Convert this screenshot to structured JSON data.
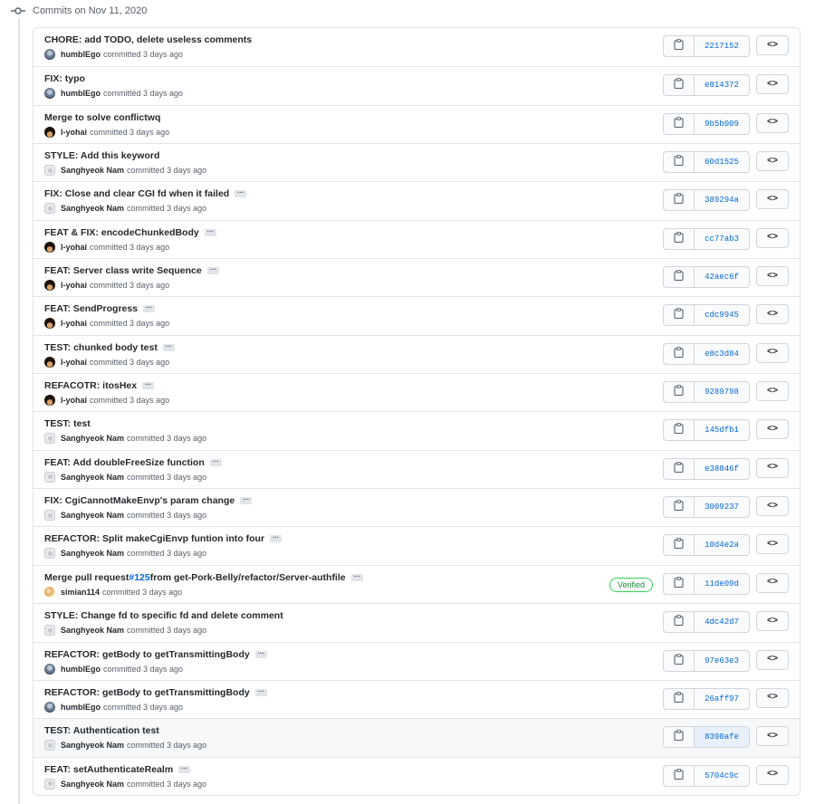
{
  "group": {
    "heading": "Commits on Nov 11, 2020"
  },
  "verb": "committed",
  "commits": [
    {
      "title": "CHORE: add TODO, delete useless comments",
      "author": "humblEgo",
      "avatar": "humble",
      "time": "3 days ago",
      "sha": "2217152",
      "has_more": false,
      "verified": false
    },
    {
      "title": "FIX: typo",
      "author": "humblEgo",
      "avatar": "humble",
      "time": "3 days ago",
      "sha": "e814372",
      "has_more": false,
      "verified": false
    },
    {
      "title": "Merge to solve conflictwq",
      "author": "l-yohai",
      "avatar": "yohai",
      "time": "3 days ago",
      "sha": "9b5b009",
      "has_more": false,
      "verified": false
    },
    {
      "title": "STYLE: Add this keyword",
      "author": "Sanghyeok Nam",
      "avatar": "default",
      "time": "3 days ago",
      "sha": "60d1525",
      "has_more": false,
      "verified": false
    },
    {
      "title": "FIX: Close and clear CGI fd when it failed",
      "author": "Sanghyeok Nam",
      "avatar": "default",
      "time": "3 days ago",
      "sha": "389294a",
      "has_more": true,
      "verified": false
    },
    {
      "title": "FEAT & FIX: encodeChunkedBody",
      "author": "l-yohai",
      "avatar": "yohai",
      "time": "3 days ago",
      "sha": "cc77ab3",
      "has_more": true,
      "verified": false
    },
    {
      "title": "FEAT: Server class write Sequence",
      "author": "l-yohai",
      "avatar": "yohai",
      "time": "3 days ago",
      "sha": "42aec6f",
      "has_more": true,
      "verified": false
    },
    {
      "title": "FEAT: SendProgress",
      "author": "l-yohai",
      "avatar": "yohai",
      "time": "3 days ago",
      "sha": "cdc9945",
      "has_more": true,
      "verified": false
    },
    {
      "title": "TEST: chunked body test",
      "author": "l-yohai",
      "avatar": "yohai",
      "time": "3 days ago",
      "sha": "e8c3d84",
      "has_more": true,
      "verified": false
    },
    {
      "title": "REFACOTR: itosHex",
      "author": "l-yohai",
      "avatar": "yohai",
      "time": "3 days ago",
      "sha": "9289798",
      "has_more": true,
      "verified": false
    },
    {
      "title": "TEST: test",
      "author": "Sanghyeok Nam",
      "avatar": "default",
      "time": "3 days ago",
      "sha": "145dfb1",
      "has_more": false,
      "verified": false
    },
    {
      "title": "FEAT: Add doubleFreeSize function",
      "author": "Sanghyeok Nam",
      "avatar": "default",
      "time": "3 days ago",
      "sha": "e38846f",
      "has_more": true,
      "verified": false
    },
    {
      "title": "FIX: CgiCannotMakeEnvp's param change",
      "author": "Sanghyeok Nam",
      "avatar": "default",
      "time": "3 days ago",
      "sha": "3009237",
      "has_more": true,
      "verified": false
    },
    {
      "title": "REFACTOR: Split makeCgiEnvp funtion into four",
      "author": "Sanghyeok Nam",
      "avatar": "default",
      "time": "3 days ago",
      "sha": "10d4e2a",
      "has_more": true,
      "verified": false
    },
    {
      "title_prefix": "Merge pull request ",
      "pr_link": "#125",
      "title_suffix": " from get-Pork-Belly/refactor/Server-authfile",
      "author": "simian114",
      "avatar": "simian",
      "time": "3 days ago",
      "sha": "11de09d",
      "has_more": true,
      "verified": true,
      "verified_label": "Verified"
    },
    {
      "title": "STYLE: Change fd to specific fd and delete comment",
      "author": "Sanghyeok Nam",
      "avatar": "default",
      "time": "3 days ago",
      "sha": "4dc42d7",
      "has_more": false,
      "verified": false
    },
    {
      "title": "REFACTOR: getBody to getTransmittingBody",
      "author": "humblEgo",
      "avatar": "humble",
      "time": "3 days ago",
      "sha": "97e63e3",
      "has_more": true,
      "verified": false
    },
    {
      "title": "REFACTOR: getBody to getTransmittingBody",
      "author": "humblEgo",
      "avatar": "humble",
      "time": "3 days ago",
      "sha": "26aff97",
      "has_more": true,
      "verified": false
    },
    {
      "title": "TEST: Authentication test",
      "author": "Sanghyeok Nam",
      "avatar": "default",
      "time": "3 days ago",
      "sha": "8390afe",
      "has_more": false,
      "verified": false,
      "highlighted": true
    },
    {
      "title": "FEAT: setAuthenticateRealm",
      "author": "Sanghyeok Nam",
      "avatar": "default",
      "time": "3 days ago",
      "sha": "5704c9c",
      "has_more": true,
      "verified": false
    }
  ],
  "icons": {
    "group": "git-commit-icon",
    "copy": "clipboard-icon",
    "browse": "code-icon",
    "more": "ellipsis-icon"
  },
  "browse_glyph": "<>",
  "more_glyph": "···"
}
